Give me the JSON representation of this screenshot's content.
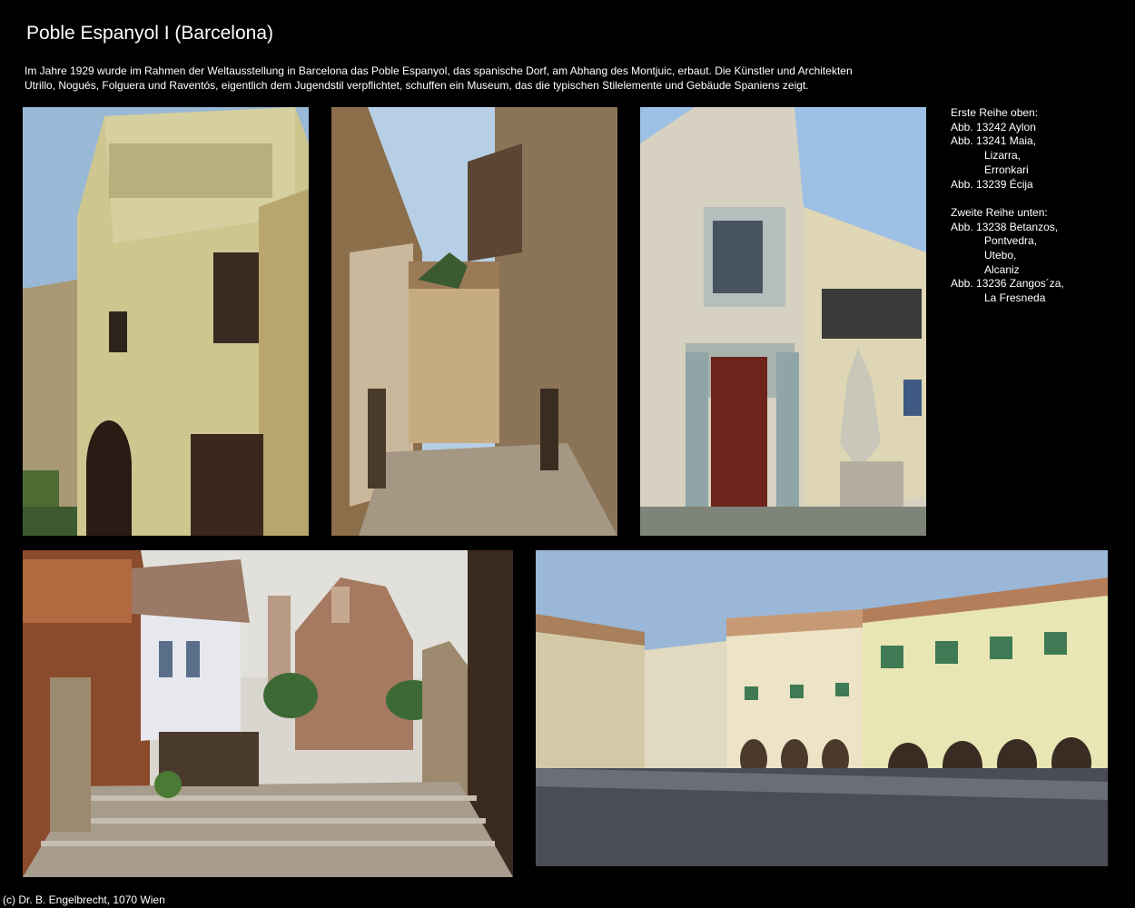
{
  "title": "Poble Espanyol I (Barcelona)",
  "intro": {
    "line1": "Im Jahre 1929 wurde im Rahmen der Weltausstellung in Barcelona das Poble Espanyol, das spanische Dorf, am Abhang des Montjuic, erbaut. Die Künstler und Architekten",
    "line2": "Utrillo, Nogués, Folguera und Raventós, eigentlich dem Jugendstil verpflichtet, schuffen ein Museum, das die typischen Stilelemente und Gebäude Spaniens zeigt."
  },
  "captions": {
    "row1_heading": "Erste Reihe oben:",
    "row1_items": [
      "Abb. 13242 Aylon",
      "Abb. 13241 Maia,",
      "Lizarra,",
      "Erronkari",
      "Abb. 13239 Écija"
    ],
    "row2_heading": "Zweite Reihe unten:",
    "row2_items": [
      "Abb. 13238 Betanzos,",
      "Pontvedra,",
      "Utebo,",
      "Alcaniz",
      "Abb. 13236 Zangos´za,",
      "La Fresneda"
    ]
  },
  "photos": {
    "p1": "Aylon",
    "p2": "Maia, Lizarra, Erronkari",
    "p3": "Écija",
    "p4": "Betanzos, Pontvedra, Utebo, Alcaniz",
    "p5": "Zangos´za, La Fresneda"
  },
  "footer": "(c) Dr. B. Engelbrecht, 1070 Wien"
}
